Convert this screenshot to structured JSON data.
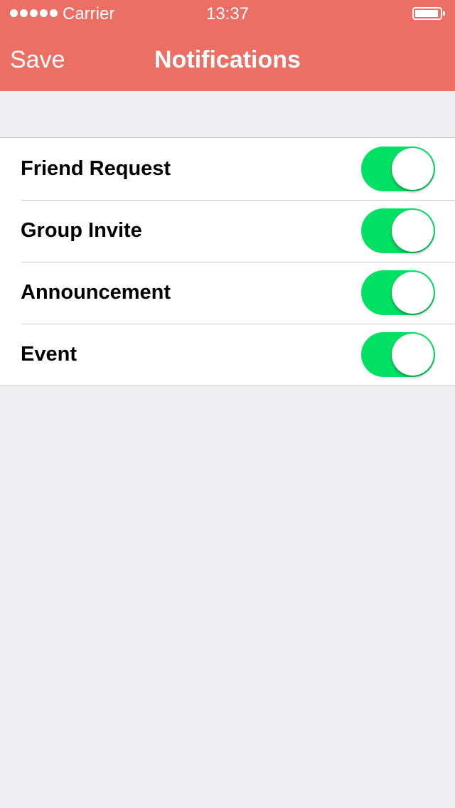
{
  "status_bar": {
    "carrier": "Carrier",
    "time": "13:37",
    "signal_dots": 5,
    "icons": [
      "signal-dots-icon",
      "battery-icon"
    ]
  },
  "nav": {
    "save_label": "Save",
    "title": "Notifications",
    "background_color": "#ec6f66"
  },
  "settings": {
    "toggle_color": "#00e163",
    "items": [
      {
        "label": "Friend Request",
        "enabled": true
      },
      {
        "label": "Group Invite",
        "enabled": true
      },
      {
        "label": "Announcement",
        "enabled": true
      },
      {
        "label": "Event",
        "enabled": true
      }
    ]
  }
}
